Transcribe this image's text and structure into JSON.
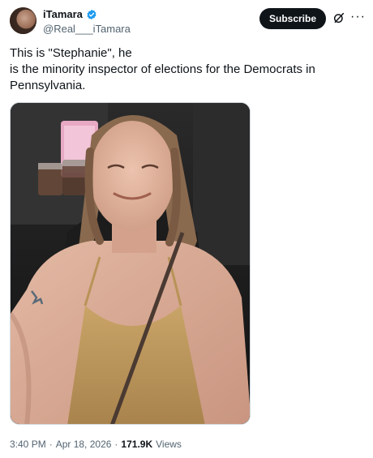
{
  "author": {
    "display_name": "iTamara",
    "handle": "@Real___iTamara",
    "verified_icon": "verified-badge-icon",
    "avatar_icon": "avatar"
  },
  "header": {
    "subscribe_label": "Subscribe",
    "grok_icon": "grok-icon",
    "more_icon": "more-options-icon"
  },
  "tweet": {
    "lines": [
      "This is \"Stephanie\", he",
      "is the minority inspector of elections for the Democrats in",
      "Pennsylvania."
    ],
    "media_type": "photo"
  },
  "meta": {
    "time": "3:40 PM",
    "separator": "·",
    "date": "Apr 18, 2026",
    "views_count": "171.9K",
    "views_label": "Views"
  },
  "colors": {
    "accent_verified": "#1d9bf0",
    "text_primary": "#0f1419",
    "text_secondary": "#536471",
    "subscribe_bg": "#0f1419"
  }
}
